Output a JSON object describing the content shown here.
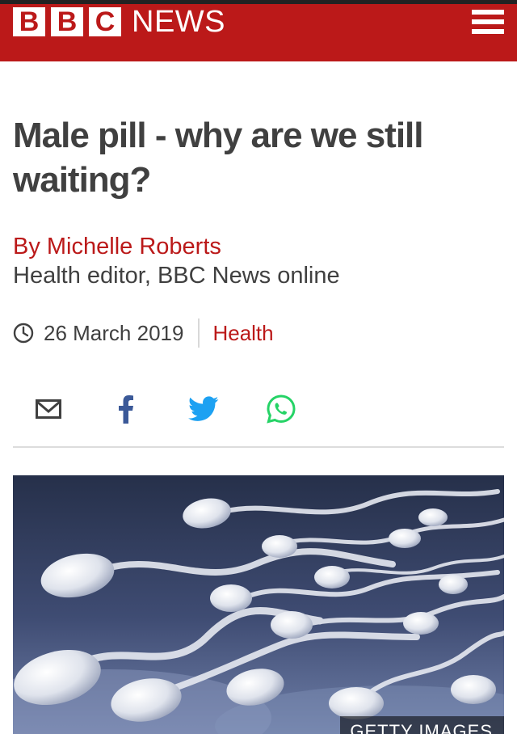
{
  "brand": {
    "letters": [
      "B",
      "B",
      "C"
    ],
    "wordmark": "NEWS",
    "bar_color": "#bb1919",
    "menu_icon": "hamburger-menu-icon"
  },
  "article": {
    "headline": "Male pill - why are we still waiting?",
    "author": "By Michelle Roberts",
    "role": "Health editor, BBC News online",
    "date": "26 March 2019",
    "topic": "Health",
    "clock_icon": "clock-icon"
  },
  "share": {
    "icons": [
      "email-icon",
      "facebook-icon",
      "twitter-icon",
      "whatsapp-icon"
    ],
    "colors": {
      "facebook": "#3b5998",
      "twitter": "#1da1f2",
      "whatsapp": "#25d366",
      "email": "#404040"
    }
  },
  "image": {
    "subject": "sperm cells illustration",
    "credit": "GETTY IMAGES"
  }
}
